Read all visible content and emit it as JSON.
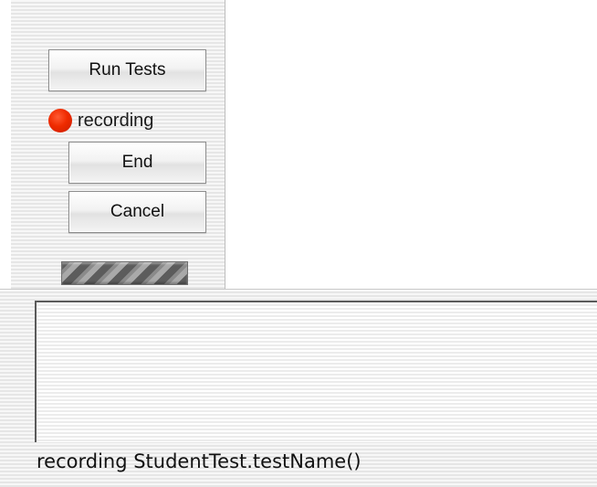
{
  "toolbar": {
    "run_tests_label": "Run Tests",
    "end_label": "End",
    "cancel_label": "Cancel"
  },
  "recording_status": {
    "label": "recording",
    "indicator_color": "#ef2b00"
  },
  "progress": {
    "indeterminate": true
  },
  "output": {
    "text": ""
  },
  "status_bar": {
    "text": "recording StudentTest.testName()"
  }
}
